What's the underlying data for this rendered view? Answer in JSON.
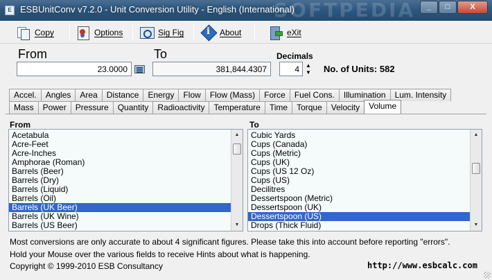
{
  "window": {
    "title": "ESBUnitConv v7.2.0 - Unit Conversion Utility - English (International)",
    "watermark": "SOFTPEDIA",
    "minimize_glyph": "_",
    "maximize_glyph": "□",
    "close_glyph": "X"
  },
  "toolbar": {
    "copy_label": "Copy",
    "options_label": "Options",
    "sigfig_label": "Sig Fig",
    "about_label": "About",
    "exit_label": "eXit"
  },
  "converter": {
    "from_label": "From",
    "from_value": "23.0000",
    "to_label": "To",
    "to_value": "381,844.4307",
    "decimals_label": "Decimals",
    "decimals_value": "4",
    "units_count": "No. of Units: 582"
  },
  "tabs": {
    "row1": [
      "Accel.",
      "Angles",
      "Area",
      "Distance",
      "Energy",
      "Flow",
      "Flow (Mass)",
      "Force",
      "Fuel Cons.",
      "Illumination",
      "Lum. Intensity"
    ],
    "row2": [
      "Mass",
      "Power",
      "Pressure",
      "Quantity",
      "Radioactivity",
      "Temperature",
      "Time",
      "Torque",
      "Velocity",
      "Volume"
    ],
    "active": "Volume"
  },
  "from_list": {
    "label": "From",
    "items": [
      "Acetabula",
      "Acre-Feet",
      "Acre-Inches",
      "Amphorae (Roman)",
      "Barrels (Beer)",
      "Barrels (Dry)",
      "Barrels (Liquid)",
      "Barrels (Oil)",
      "Barrels (UK Beer)",
      "Barrels (UK Wine)",
      "Barrels (US Beer)"
    ],
    "selected": "Barrels (UK Beer)"
  },
  "to_list": {
    "label": "To",
    "items": [
      "Cubic Yards",
      "Cups (Canada)",
      "Cups (Metric)",
      "Cups (UK)",
      "Cups (US 12 Oz)",
      "Cups (US)",
      "Decilitres",
      "Dessertspoon (Metric)",
      "Dessertspoon (UK)",
      "Dessertspoon (US)",
      "Drops (Thick Fluid)"
    ],
    "selected": "Dessertspoon (US)"
  },
  "status": {
    "line1": "Most conversions are only accurate to about 4 significant figures. Please take this into account before reporting \"errors\".",
    "line2": "Hold your Mouse over the various fields to receive Hints about what is happening.",
    "copyright": "Copyright © 1999-2010 ESB Consultancy",
    "url": "http://www.esbcalc.com"
  }
}
